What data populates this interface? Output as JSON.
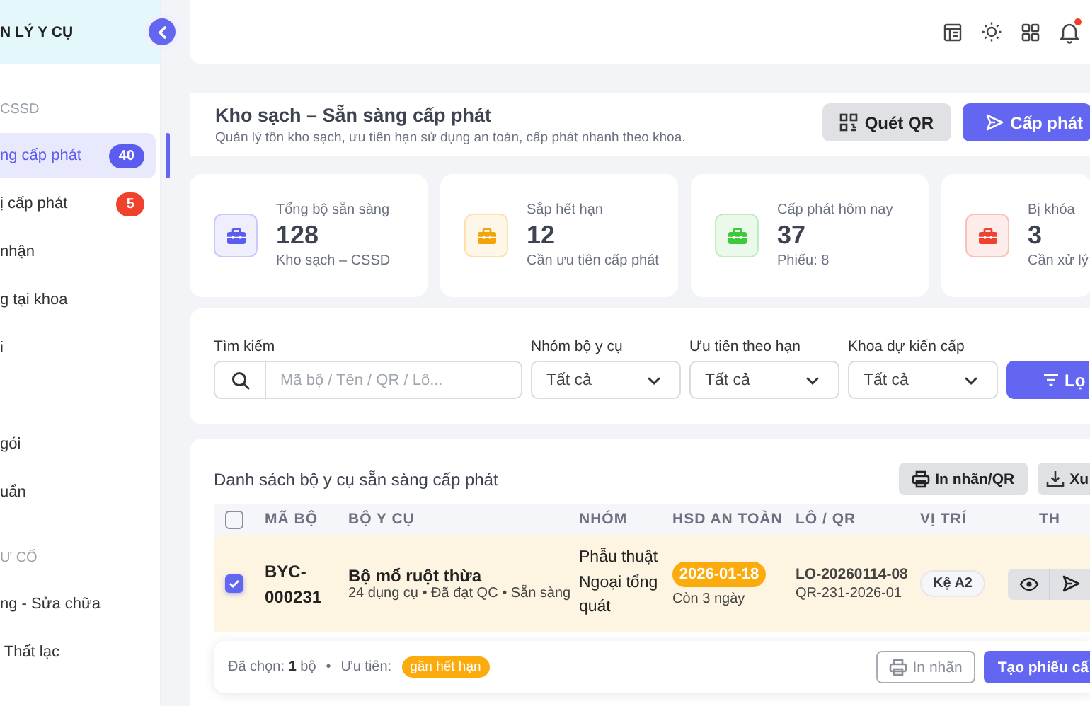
{
  "sidebar": {
    "title": "N LÝ Y CỤ",
    "groups": [
      {
        "heading": "CSSD",
        "items": [
          {
            "label": "ng cấp phát",
            "selected": true,
            "badge": "40",
            "color": "#5b5cf0"
          },
          {
            "label": "ị cấp phát",
            "selected": false,
            "badge": "5",
            "color": "#f0412c"
          },
          {
            "label": "nhận",
            "selected": false
          },
          {
            "label": "g tại khoa",
            "selected": false
          },
          {
            "label": "i",
            "selected": false
          }
        ]
      },
      {
        "items": [
          {
            "label": "gói",
            "selected": false
          },
          {
            "label": "uẩn",
            "selected": false
          }
        ]
      },
      {
        "heading": "Ư CỐ",
        "items": [
          {
            "label": "ng - Sửa chữa",
            "selected": false
          },
          {
            "label": " Thất lạc",
            "selected": false
          }
        ]
      }
    ]
  },
  "topbar": {
    "notification_dot": true
  },
  "header": {
    "title": "Kho sạch – Sẵn sàng cấp phát",
    "subtitle": "Quản lý tồn kho sạch, ưu tiên hạn sử dụng an toàn, cấp phát nhanh theo khoa.",
    "buttons": [
      {
        "label": "Quét QR",
        "kind": "qr"
      },
      {
        "label": "Cấp phát",
        "kind": "send"
      }
    ]
  },
  "stats": [
    {
      "label": "Tổng bộ sẵn sàng",
      "value": "128",
      "note": "Kho sạch – CSSD",
      "color": "#5b5cf0"
    },
    {
      "label": "Sắp hết hạn",
      "value": "12",
      "note": "Cần ưu tiên cấp phát",
      "color": "#f5a30a"
    },
    {
      "label": "Cấp phát hôm nay",
      "value": "37",
      "note": "Phiếu: 8",
      "color": "#3cc93c"
    },
    {
      "label": "Bị khóa",
      "value": "3",
      "note": "Cần xử lý",
      "color": "#f0412c"
    }
  ],
  "filters": {
    "search": {
      "label": "Tìm kiếm",
      "placeholder": "Mã bộ / Tên / QR / Lô..."
    },
    "selects": [
      {
        "label": "Nhóm bộ y cụ",
        "value": "Tất cả"
      },
      {
        "label": "Ưu tiên theo hạn",
        "value": "Tất cả"
      },
      {
        "label": "Khoa dự kiến cấp",
        "value": "Tất cả"
      }
    ],
    "button": "Lọ"
  },
  "table": {
    "title": "Danh sách bộ y cụ sẵn sàng cấp phát",
    "actions": [
      {
        "label": "In nhãn/QR",
        "kind": "print"
      },
      {
        "label": "Xu",
        "kind": "download"
      }
    ],
    "header_checked": false,
    "columns": [
      "MÃ BỘ",
      "BỘ Y CỤ",
      "NHÓM",
      "HSD AN TOÀN",
      "LÔ / QR",
      "VỊ TRÍ",
      "TH"
    ],
    "rows": [
      {
        "selected": true,
        "code": "BYC-000231",
        "name": "Bộ mổ ruột thừa",
        "details": "24 dụng cụ • Đã đạt QC • Sẵn sàng",
        "group": "Phẫu thuật Ngoại tổng quát",
        "expiry": "2026-01-18",
        "remaining": "Còn 3 ngày",
        "lot": "LO-20260114-08",
        "qr": "QR-231-2026-01",
        "location": "Kệ A2"
      }
    ]
  },
  "selection_bar": {
    "text": "Đã chọn: **1** bộ",
    "separator": "•",
    "priority_label": "Ưu tiên:",
    "priority_tag": "gần hết hạn",
    "buttons": [
      {
        "label": "In nhãn",
        "kind": "outline"
      },
      {
        "label": "Tạo phiếu cấ",
        "kind": "primary"
      }
    ]
  }
}
